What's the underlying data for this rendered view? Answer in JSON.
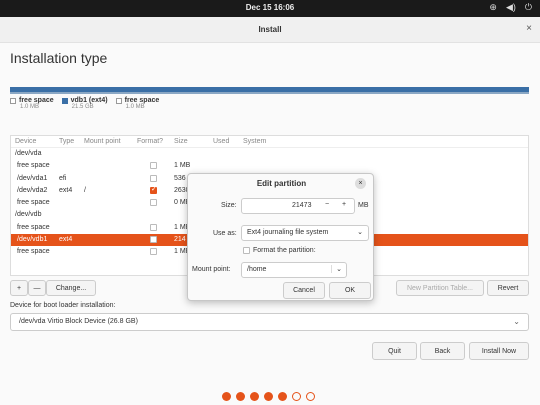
{
  "topbar": {
    "clock": "Dec 15  16:06",
    "tray_network": "⊕",
    "tray_volume": "◀)",
    "tray_power": "⏻"
  },
  "window": {
    "title": "Install",
    "close": "×"
  },
  "page": {
    "heading": "Installation type"
  },
  "legend": [
    {
      "name": "free space",
      "size": "1.0 MB"
    },
    {
      "name": "vdb1 (ext4)",
      "size": "21.5 GB"
    },
    {
      "name": "free space",
      "size": "1.0 MB"
    }
  ],
  "table": {
    "headers": [
      "Device",
      "Type",
      "Mount point",
      "Format?",
      "Size",
      "Used",
      "System"
    ],
    "rows": [
      {
        "device": "/dev/vda",
        "type": "",
        "mount": "",
        "size": ""
      },
      {
        "device": "  free space",
        "type": "",
        "mount": "",
        "size": "1 MB"
      },
      {
        "device": "  /dev/vda1",
        "type": "efi",
        "mount": "",
        "size": "536"
      },
      {
        "device": "  /dev/vda2",
        "type": "ext4",
        "mount": "/",
        "size": "2630"
      },
      {
        "device": "  free space",
        "type": "",
        "mount": "",
        "size": "0 MB"
      },
      {
        "device": "/dev/vdb",
        "type": "",
        "mount": "",
        "size": ""
      },
      {
        "device": "  free space",
        "type": "",
        "mount": "",
        "size": "1 MB"
      },
      {
        "device": "  /dev/vdb1",
        "type": "ext4",
        "mount": "",
        "size": "214"
      },
      {
        "device": "  free space",
        "type": "",
        "mount": "",
        "size": "1 MB"
      }
    ]
  },
  "toolbar": {
    "add": "+",
    "remove": "—",
    "change": "Change...",
    "new_table": "New Partition Table...",
    "revert": "Revert"
  },
  "bootloader": {
    "label": "Device for boot loader installation:",
    "value": "/dev/vda   Virtio Block Device (26.8 GB)"
  },
  "buttons": {
    "quit": "Quit",
    "back": "Back",
    "install": "Install Now"
  },
  "dialog": {
    "title": "Edit partition",
    "close": "×",
    "size_label": "Size:",
    "size_value": "21473",
    "size_minus": "−",
    "size_plus": "+",
    "size_unit": "MB",
    "useas_label": "Use as:",
    "useas_value": "Ext4 journaling file system",
    "format_label": "Format the partition:",
    "mount_label": "Mount point:",
    "mount_value": "/home",
    "cancel": "Cancel",
    "ok": "OK"
  },
  "colors": {
    "accent": "#e5531a",
    "diskbar": "#3a6fa6"
  }
}
